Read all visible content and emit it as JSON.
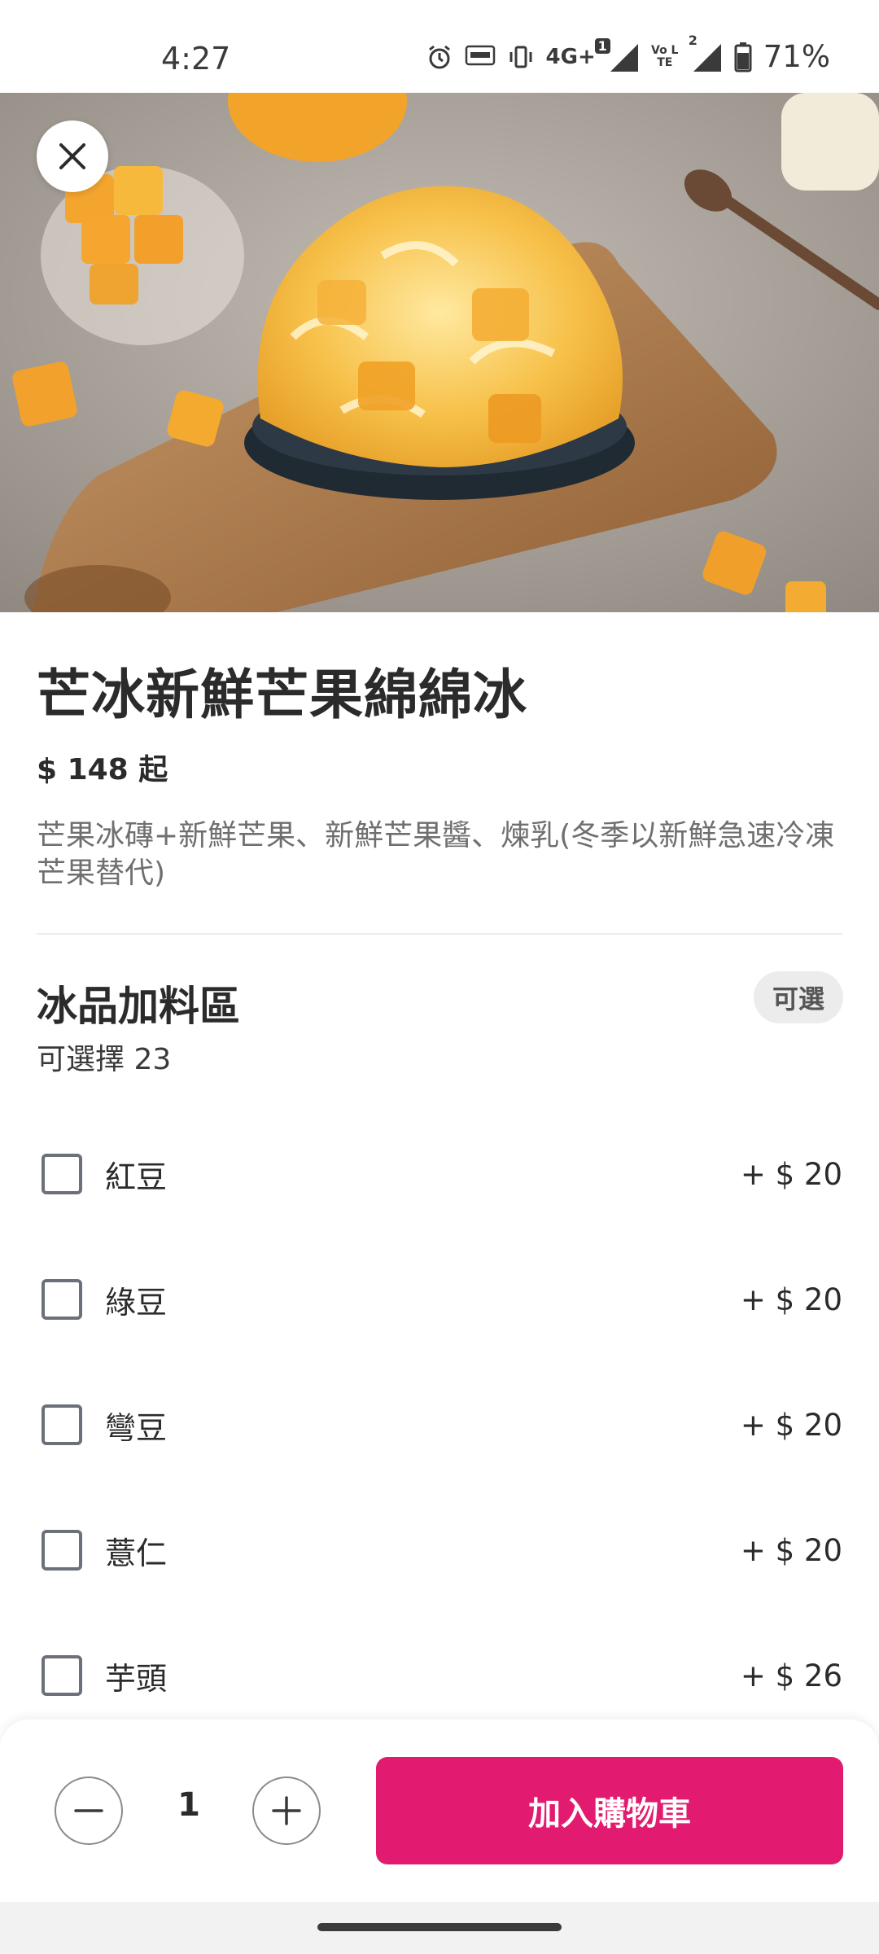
{
  "status_bar": {
    "time": "4:27",
    "battery": "71%",
    "icons": [
      "alarm-icon",
      "auto-hz-icon",
      "vibrate-icon",
      "4g-plus-icon",
      "signal-icon",
      "volte-icon",
      "signal-icon",
      "battery-icon"
    ],
    "network": "4G+",
    "sim1_badge": "1",
    "sim2_badge": "2",
    "volte": "Vo LTE"
  },
  "product": {
    "image_alt": "mango shaved ice photo",
    "title": "芒冰新鮮芒果綿綿冰",
    "price": "$ 148 起",
    "description": "芒果冰磚+新鮮芒果、新鮮芒果醬、煉乳(冬季以新鮮急速冷凍芒果替代)"
  },
  "addons": {
    "title": "冰品加料區",
    "subtitle": "可選擇 23",
    "badge": "可選",
    "options": [
      {
        "label": "紅豆",
        "price": "+ $ 20"
      },
      {
        "label": "綠豆",
        "price": "+ $ 20"
      },
      {
        "label": "彎豆",
        "price": "+ $ 20"
      },
      {
        "label": "薏仁",
        "price": "+ $ 20"
      },
      {
        "label": "芋頭",
        "price": "+ $ 26"
      }
    ]
  },
  "cart": {
    "quantity": "1",
    "add_label": "加入購物車"
  },
  "colors": {
    "accent": "#e21b70",
    "text": "#2b2b2b",
    "muted": "#6f6f6f"
  }
}
